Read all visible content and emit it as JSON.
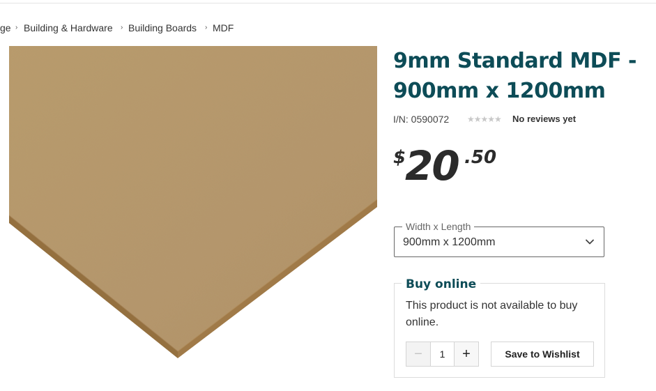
{
  "breadcrumb": {
    "items": [
      "ge",
      "Building & Hardware",
      "Building Boards",
      "MDF"
    ],
    "separator": "›"
  },
  "product": {
    "title": "9mm Standard MDF - 900mm x 1200mm",
    "item_number": "I/N: 0590072",
    "rating_stars": "★★★★★",
    "reviews_text": "No reviews yet",
    "image_icon": "mdf-board-image"
  },
  "price": {
    "currency": "$",
    "dollars": "20",
    "cents": ".50"
  },
  "variant_select": {
    "label": "Width x Length",
    "value": "900mm x 1200mm",
    "icon": "chevron-down-icon"
  },
  "buy_online": {
    "title": "Buy online",
    "message": "This product is not available to buy online.",
    "quantity": "1",
    "minus_label": "−",
    "plus_label": "+",
    "wishlist_label": "Save to Wishlist"
  },
  "colors": {
    "brand_teal": "#0d4c57",
    "board_top": "#b99a68",
    "board_edge": "#8a6a3e"
  }
}
